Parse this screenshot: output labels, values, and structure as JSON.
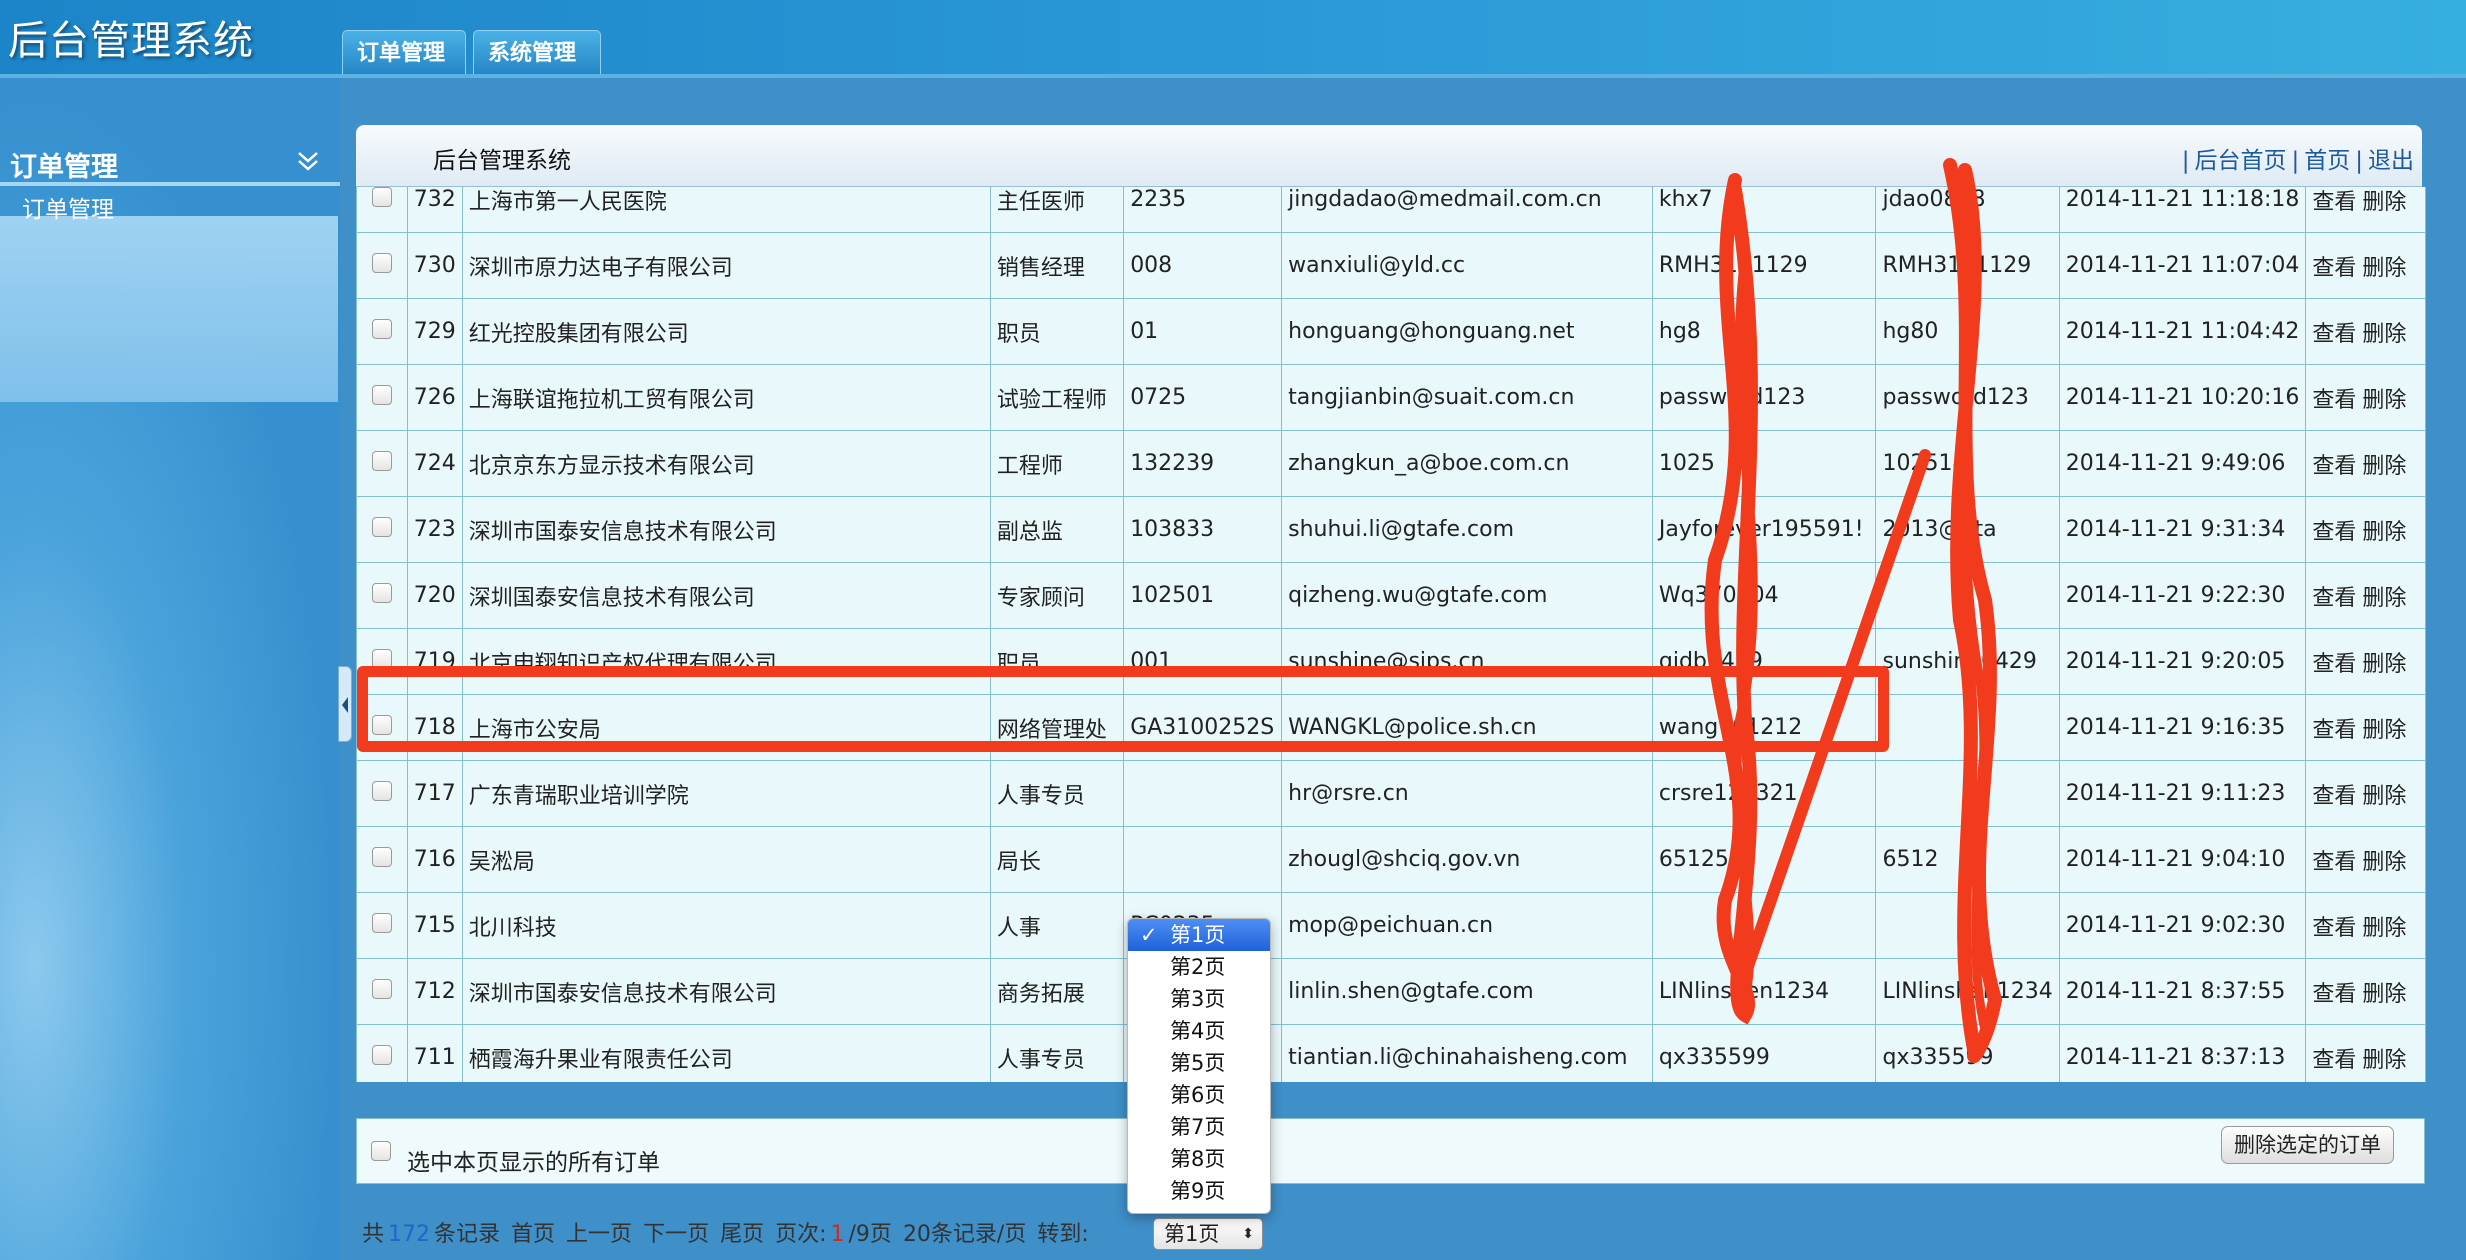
{
  "app": {
    "title": "后台管理系统"
  },
  "top_tabs": [
    {
      "label": "订单管理"
    },
    {
      "label": "系统管理"
    }
  ],
  "sidebar": {
    "title": "订单管理",
    "items": [
      {
        "label": "订单管理"
      }
    ]
  },
  "panel": {
    "title": "后台管理系统",
    "links": [
      "后台首页",
      "首页",
      "退出"
    ],
    "link_separator": "|"
  },
  "orders": {
    "rows": [
      {
        "id": "732",
        "company": "上海市第一人民医院",
        "position": "主任医师",
        "code": "2235",
        "email": "jingdadao@medmail.com.cn",
        "user": "khx7",
        "pass": "jdao0828",
        "time": "2014-11-21 11:18:18"
      },
      {
        "id": "730",
        "company": "深圳市原力达电子有限公司",
        "position": "销售经理",
        "code": "008",
        "email": "wanxiuli@yld.cc",
        "user": "RMH3121129",
        "pass": "RMH3121129",
        "time": "2014-11-21 11:07:04"
      },
      {
        "id": "729",
        "company": "红光控股集团有限公司",
        "position": "职员",
        "code": "01",
        "email": "honguang@honguang.net",
        "user": "hg8",
        "pass": "hg80",
        "time": "2014-11-21 11:04:42"
      },
      {
        "id": "726",
        "company": "上海联谊拖拉机工贸有限公司",
        "position": "试验工程师",
        "code": "0725",
        "email": "tangjianbin@suait.com.cn",
        "user": "password123",
        "pass": "password123",
        "time": "2014-11-21 10:20:16"
      },
      {
        "id": "724",
        "company": "北京京东方显示技术有限公司",
        "position": "工程师",
        "code": "132239",
        "email": "zhangkun_a@boe.com.cn",
        "user": "1025",
        "pass": "102514",
        "time": "2014-11-21 9:49:06"
      },
      {
        "id": "723",
        "company": "深圳市国泰安信息技术有限公司",
        "position": "副总监",
        "code": "103833",
        "email": "shuhui.li@gtafe.com",
        "user": "Jayforever195591!",
        "pass": "2013@gta",
        "time": "2014-11-21 9:31:34"
      },
      {
        "id": "720",
        "company": "深圳国泰安信息技术有限公司",
        "position": "专家顾问",
        "code": "102501",
        "email": "qizheng.wu@gtafe.com",
        "user": "Wq370604",
        "pass": "",
        "time": "2014-11-21 9:22:30"
      },
      {
        "id": "719",
        "company": "北京申翔知识产权代理有限公司",
        "position": "职员",
        "code": "001",
        "email": "sunshine@sips.cn",
        "user": "qidb0429",
        "pass": "sunshine0429",
        "time": "2014-11-21 9:20:05"
      },
      {
        "id": "718",
        "company": "上海市公安局",
        "position": "网络管理处",
        "code": "GA3100252S",
        "email": "WANGKL@police.sh.cn",
        "user": "wang701212",
        "pass": "",
        "time": "2014-11-21 9:16:35"
      },
      {
        "id": "717",
        "company": "广东青瑞职业培训学院",
        "position": "人事专员",
        "code": "",
        "email": "hr@rsre.cn",
        "user": "crsre123321",
        "pass": "",
        "time": "2014-11-21 9:11:23"
      },
      {
        "id": "716",
        "company": "吴淞局",
        "position": "局长",
        "code": "",
        "email": "zhougl@shciq.gov.vn",
        "user": "651257",
        "pass": "6512",
        "time": "2014-11-21 9:04:10"
      },
      {
        "id": "715",
        "company": "北川科技",
        "position": "人事",
        "code": "PC0235",
        "email": "mop@peichuan.cn",
        "user": "",
        "pass": "",
        "time": "2014-11-21 9:02:30"
      },
      {
        "id": "712",
        "company": "深圳市国泰安信息技术有限公司",
        "position": "商务拓展",
        "code": "",
        "email": "linlin.shen@gtafe.com",
        "user": "LINlinshen1234",
        "pass": "LINlinshen1234",
        "time": "2014-11-21 8:37:55"
      },
      {
        "id": "711",
        "company": "栖霞海升果业有限责任公司",
        "position": "人事专员",
        "code": "",
        "email": "tiantian.li@chinahaisheng.com",
        "user": "qx335599",
        "pass": "qx335599",
        "time": "2014-11-21 8:37:13"
      }
    ],
    "action_view": "查看",
    "action_delete": "删除"
  },
  "footer": {
    "select_all_label": "选中本页显示的所有订单",
    "delete_button": "删除选定的订单",
    "pager": {
      "total_prefix": "共",
      "total": "172",
      "total_suffix": "条记录",
      "first": "首页",
      "prev": "上一页",
      "next": "下一页",
      "last": "尾页",
      "page_label": "页次:",
      "current": "1",
      "of_pages": "/9页",
      "per_page": "20条记录/页",
      "goto": "转到:",
      "selected_page": "第1页"
    }
  },
  "page_dropdown": {
    "options": [
      "第1页",
      "第2页",
      "第3页",
      "第4页",
      "第5页",
      "第6页",
      "第7页",
      "第8页",
      "第9页"
    ],
    "selected_index": 0
  },
  "colors": {
    "annotation": "#f23a1c",
    "link": "#1d5a9c",
    "accent_blue": "#1e66c9"
  }
}
